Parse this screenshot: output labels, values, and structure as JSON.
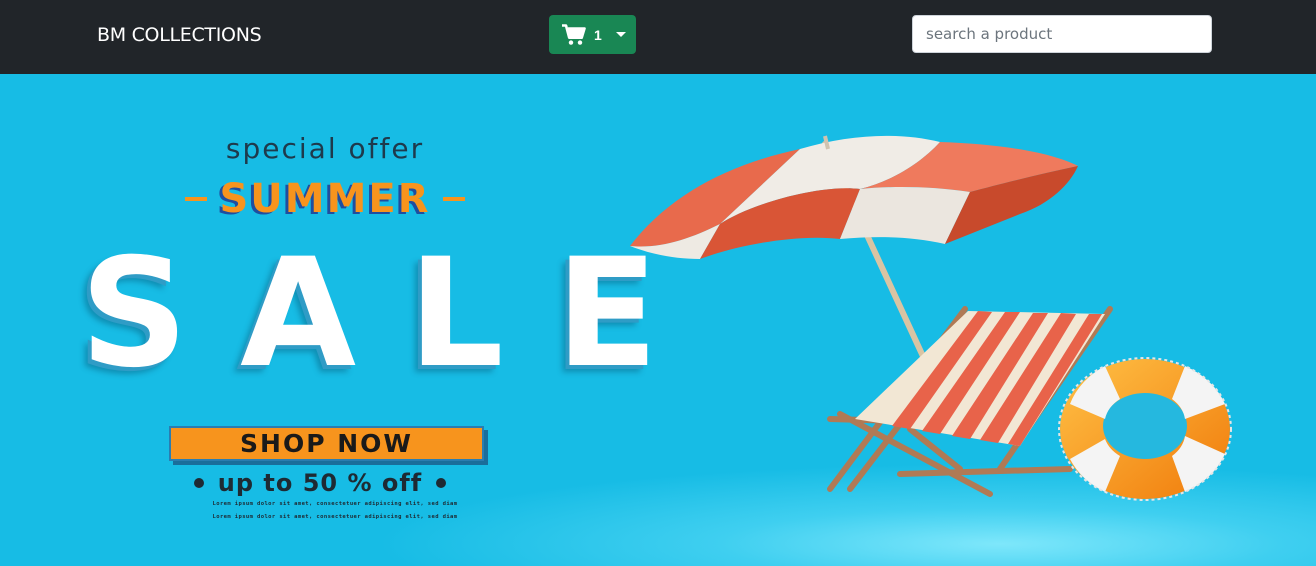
{
  "navbar": {
    "brand": "BM COLLECTIONS",
    "cart": {
      "count": "1",
      "icon": "shopping-cart-icon"
    },
    "search": {
      "placeholder": "search a product",
      "value": ""
    }
  },
  "banner": {
    "special": "special offer",
    "summer": "SUMMER",
    "sale": "SALE",
    "cta": "SHOP NOW",
    "discount": "up to 50 % off",
    "lorem_lines": [
      "Lorem ipsum dolor sit amet, consectetuer adipiscing elit, sed diam",
      "Lorem ipsum dolor sit amet, consectetuer adipiscing elit, sed diam"
    ]
  },
  "colors": {
    "navbar_bg": "#212529",
    "cart_button": "#198754",
    "hero_bg": "#17bce5",
    "accent_orange": "#f7941d"
  }
}
